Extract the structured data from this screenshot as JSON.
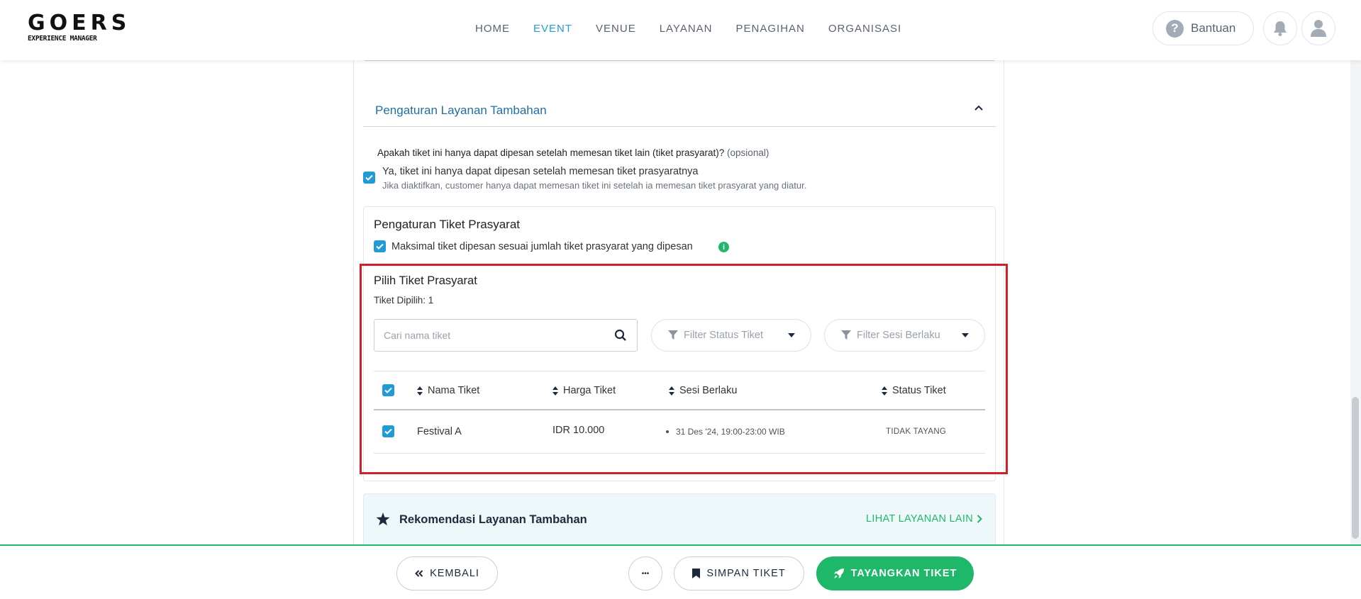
{
  "brand": {
    "logo_main": "GOERS",
    "logo_sub": "EXPERIENCE MANAGER"
  },
  "nav": {
    "items": [
      {
        "label": "HOME"
      },
      {
        "label": "EVENT",
        "active": true
      },
      {
        "label": "VENUE"
      },
      {
        "label": "LAYANAN"
      },
      {
        "label": "PENAGIHAN"
      },
      {
        "label": "ORGANISASI"
      }
    ],
    "help_label": "Bantuan"
  },
  "section": {
    "title": "Pengaturan Layanan Tambahan",
    "question": "Apakah tiket ini hanya dapat dipesan setelah memesan tiket lain (tiket prasyarat)?",
    "question_optional": "(opsional)",
    "yes_label": "Ya, tiket ini hanya dapat dipesan setelah memesan tiket prasyaratnya",
    "yes_sub": "Jika diaktifkan, customer hanya dapat memesan tiket ini setelah ia memesan tiket prasyarat yang diatur."
  },
  "prasyarat": {
    "title": "Pengaturan Tiket Prasyarat",
    "max_label": "Maksimal tiket dipesan sesuai jumlah tiket prasyarat yang dipesan",
    "pilih_title": "Pilih Tiket Prasyarat",
    "dipilih": "Tiket Dipilih: 1",
    "search_placeholder": "Cari nama tiket",
    "filter_status": "Filter Status Tiket",
    "filter_sesi": "Filter Sesi Berlaku",
    "columns": [
      "Nama Tiket",
      "Harga Tiket",
      "Sesi Berlaku",
      "Status Tiket"
    ],
    "rows": [
      {
        "nama": "Festival A",
        "harga": "IDR 10.000",
        "sesi": "31 Des '24, 19:00-23:00 WIB",
        "status": "TIDAK TAYANG"
      }
    ]
  },
  "rekomendasi": {
    "title": "Rekomendasi Layanan Tambahan",
    "link": "LIHAT LAYANAN LAIN"
  },
  "footer": {
    "back": "KEMBALI",
    "more": "•••",
    "save": "SIMPAN TIKET",
    "publish": "TAYANGKAN TIKET"
  },
  "colors": {
    "accent": "#1f9bd7",
    "green": "#1fb86a",
    "highlight": "#d0202a"
  }
}
